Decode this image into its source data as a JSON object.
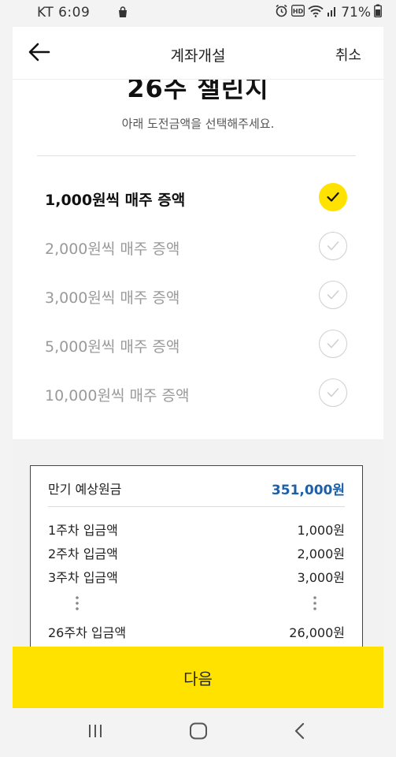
{
  "status_bar": {
    "carrier_time": "KT 6:09",
    "battery": "71%",
    "icons": [
      "shopping-bag-icon",
      "alarm-icon",
      "hd-icon",
      "wifi-icon",
      "signal-icon",
      "battery-icon"
    ]
  },
  "app_bar": {
    "title": "계좌개설",
    "cancel_label": "취소",
    "back_icon": "arrow-left-icon"
  },
  "header": {
    "challenge_title": "26주 챌린지",
    "subtitle": "아래 도전금액을 선택해주세요."
  },
  "options": [
    {
      "label": "1,000원씩 매주 증액",
      "selected": true
    },
    {
      "label": "2,000원씩 매주 증액",
      "selected": false
    },
    {
      "label": "3,000원씩 매주 증액",
      "selected": false
    },
    {
      "label": "5,000원씩 매주 증액",
      "selected": false
    },
    {
      "label": "10,000원씩 매주 증액",
      "selected": false
    }
  ],
  "summary": {
    "total_label": "만기 예상원금",
    "total_value": "351,000원",
    "rows": [
      {
        "label": "1주차 입금액",
        "value": "1,000원"
      },
      {
        "label": "2주차 입금액",
        "value": "2,000원"
      },
      {
        "label": "3주차 입금액",
        "value": "3,000원"
      },
      {
        "label": "26주차 입금액",
        "value": "26,000원"
      }
    ]
  },
  "next_label": "다음",
  "colors": {
    "accent_yellow": "#ffe200",
    "total_blue": "#1f5fa8"
  },
  "nav": [
    "recent-apps-icon",
    "home-icon",
    "back-icon"
  ]
}
